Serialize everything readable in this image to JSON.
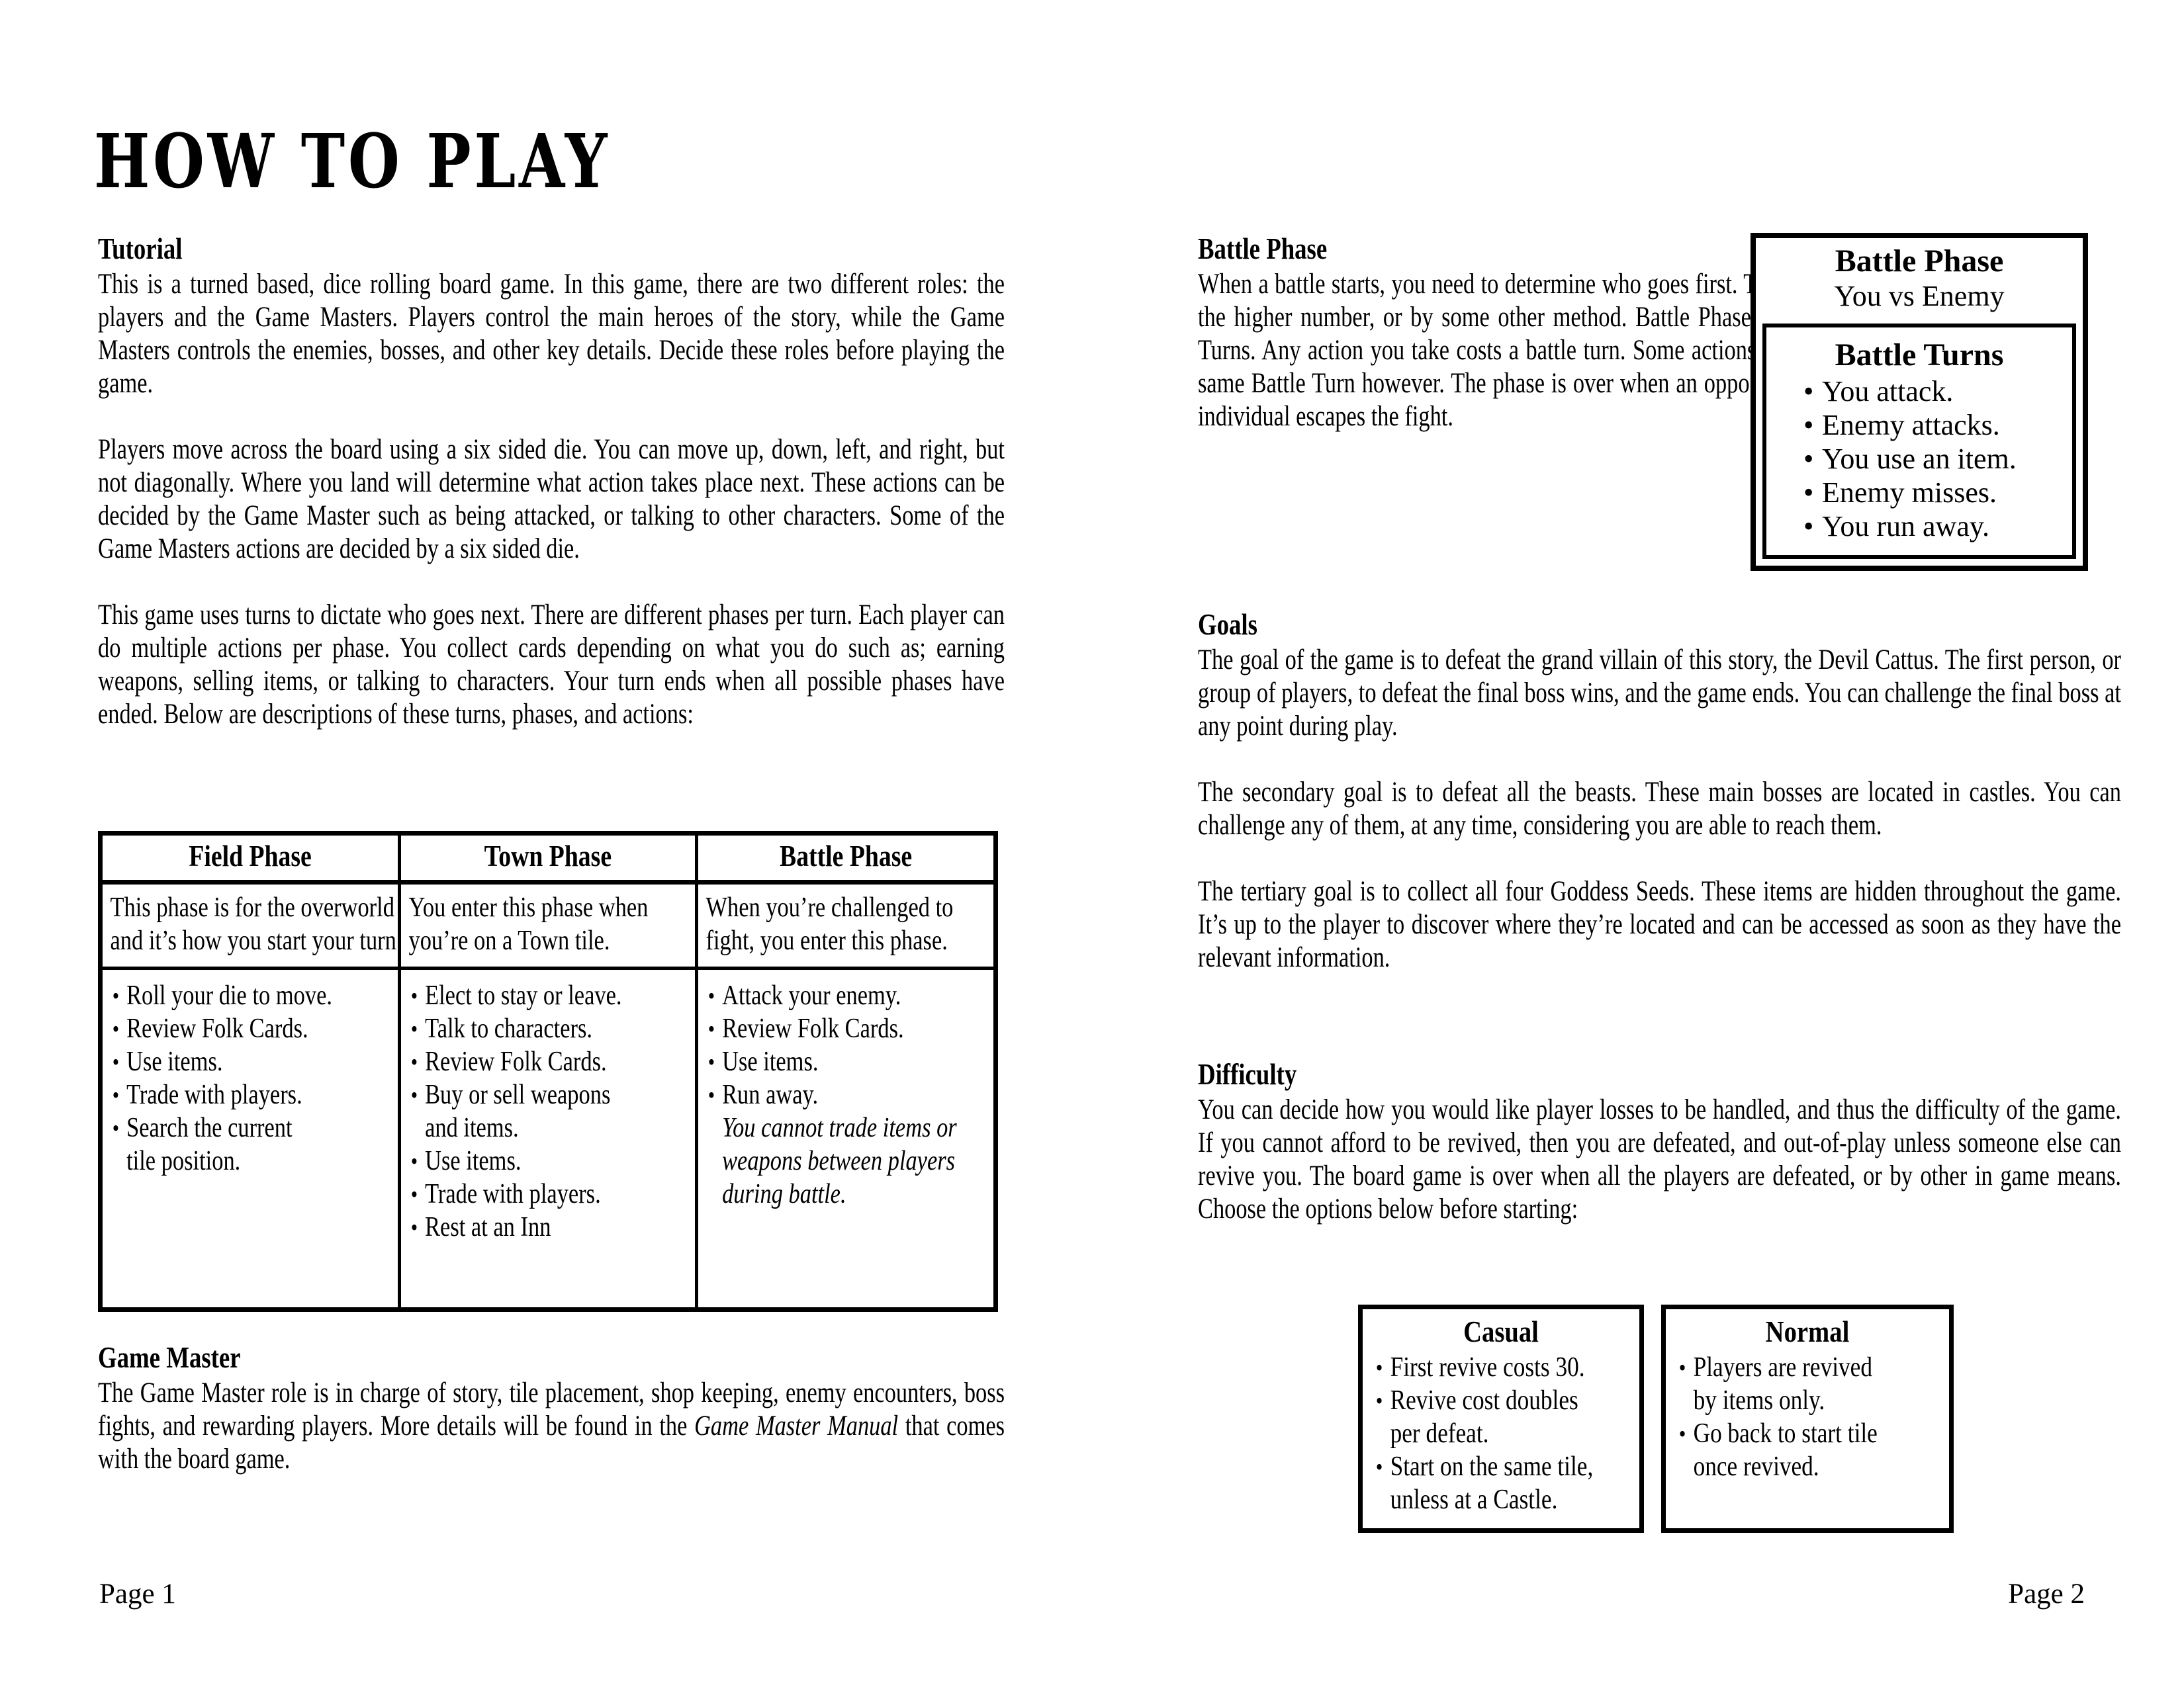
{
  "document": {
    "title": "HOW TO PLAY"
  },
  "left_column": {
    "tutorial": {
      "heading": "Tutorial",
      "paragraphs": [
        "This is a turned based, dice rolling board game. In this game, there are two different roles: the players and the Game Masters. Players control the main heroes of the story, while the Game Masters controls the enemies, bosses, and other key details. Decide these roles before playing the game.",
        "Players move across the board using a six sided die. You can move up, down, left, and right, but not diagonally. Where you land will determine what action takes place next. These actions can be decided by the Game Master such as being attacked, or talking to other characters. Some of the Game Masters actions are decided by a six sided die.",
        "This game uses turns to dictate who goes next. There are different phases per turn. Each player can do multiple actions per phase. You collect cards depending on what you do such as; earning weapons, selling items, or talking to characters. Your turn ends when all possible phases have ended. Below are descriptions of these turns, phases, and actions:"
      ]
    },
    "game_master": {
      "heading": "Game Master",
      "text_before_italic": "The Game Master role is in charge of story, tile placement, shop keeping, enemy encounters, boss fights, and rewarding players. More details will be found in the ",
      "italic_title": "Game Master Manual",
      "text_after_italic": " that comes with the board game."
    }
  },
  "phase_table": {
    "headers": [
      "Field Phase",
      "Town Phase",
      "Battle Phase"
    ],
    "descriptions": [
      "This phase is for the overworld and it’s how you start your turn.",
      "You enter this phase when you’re on a Town tile.",
      "When you’re challenged to fight, you enter this phase."
    ],
    "field_bullets": [
      "Roll your die to move.",
      "Review Folk Cards.",
      "Use items.",
      "Trade with players.",
      "Search the current"
    ],
    "field_continuation": "tile position.",
    "town_bullets": [
      "Elect to stay or leave.",
      "Talk to characters.",
      "Review Folk Cards.",
      "Buy or sell weapons"
    ],
    "town_continuation": "and items.",
    "town_bullets_rest": [
      "Use items.",
      "Trade with players.",
      "Rest at an Inn"
    ],
    "battle_bullets": [
      "Attack your enemy.",
      "Review Folk Cards.",
      "Use items.",
      "Run away."
    ],
    "battle_note": "You cannot trade items or weapons between players during battle."
  },
  "right_column": {
    "battle_phase": {
      "heading": "Battle Phase",
      "paragraph": "When a battle starts, you need to determine who goes first. This can be done by rolling the higher number, or by some other method. Battle Phases are segmented by Battle Turns. Any action you take costs a battle turn. Some actions can take place during the same Battle Turn however.  The phase is over when an opposing side is defeated, or an individual escapes the fight."
    },
    "goals": {
      "heading": "Goals",
      "paragraphs": [
        "The goal of the game is to defeat the grand villain of this story, the Devil Cattus. The first person, or group of players, to defeat the final boss wins, and the game ends. You can challenge the final boss at any point during play.",
        "The secondary goal is to defeat all the beasts. These main bosses are located in castles. You can challenge any of them, at any time, considering you are able to reach them.",
        "The tertiary goal is to collect all four Goddess Seeds. These items are hidden throughout the game. It’s up to the player to discover where they’re located and can be accessed as soon as they have the relevant information."
      ]
    },
    "difficulty": {
      "heading": "Difficulty",
      "paragraph": "You can decide how you would like player losses to be handled, and thus the difficulty of the game. If you cannot afford to be revived, then you are defeated, and out-of-play unless someone else can revive you. The board game is over when all the players are defeated, or by other in game means. Choose the options below before starting:"
    }
  },
  "battle_box": {
    "title": "Battle Phase",
    "subtitle": "You vs Enemy",
    "inner_title": "Battle Turns",
    "turns": [
      "You attack.",
      "Enemy attacks.",
      "You use an item.",
      "Enemy misses.",
      "You run away."
    ]
  },
  "difficulty_boxes": {
    "casual": {
      "title": "Casual",
      "bullets": [
        "First revive costs 30.",
        "Revive cost doubles"
      ],
      "casual_cont_1": "per defeat.",
      "bullets2": [
        "Start on the same tile,"
      ],
      "casual_cont_2": "unless at a Castle."
    },
    "normal": {
      "title": "Normal",
      "bullets": [
        "Players are revived"
      ],
      "normal_cont_1": "by items only.",
      "bullets2": [
        "Go back to start tile"
      ],
      "normal_cont_2": "once revived."
    }
  },
  "footer": {
    "left": "Page 1",
    "right": "Page 2"
  }
}
